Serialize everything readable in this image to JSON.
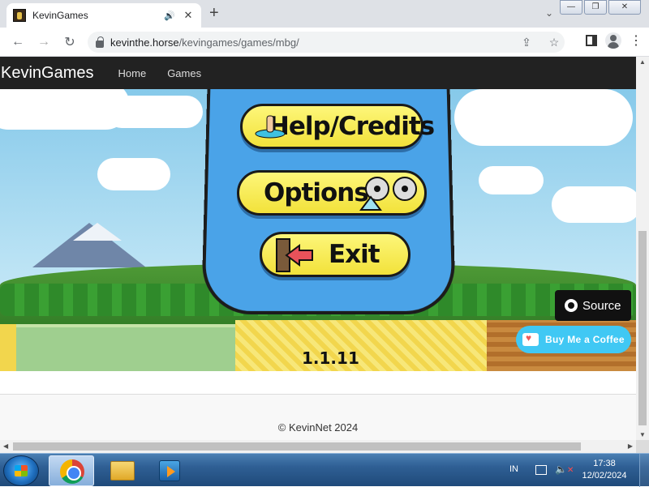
{
  "browser": {
    "tab": {
      "title": "KevinGames",
      "audio_icon": "speaker-icon",
      "close_icon": "close-icon"
    },
    "new_tab_icon": "plus-icon",
    "tab_search_icon": "chevron-down-icon",
    "window_controls": [
      "minimize",
      "restore",
      "close"
    ],
    "address": {
      "domain": "kevinthe.horse",
      "path": "/kevingames/games/mbg/"
    },
    "nav_icons": [
      "back-arrow-icon",
      "forward-arrow-icon",
      "reload-icon"
    ],
    "omnibox_icons": [
      "share-icon",
      "bookmark-star-icon"
    ],
    "toolbar_icons": [
      "side-panel-icon",
      "profile-icon",
      "menu-icon"
    ]
  },
  "site": {
    "brand": "KevinGames",
    "nav": [
      {
        "label": "Home"
      },
      {
        "label": "Games"
      }
    ]
  },
  "game": {
    "menu_buttons": [
      {
        "label": "Help/Credits",
        "icon": "drowning-hand-icon"
      },
      {
        "label": "Options",
        "icon": "film-reels-icon"
      },
      {
        "label": "Exit",
        "icon": "exit-door-arrow-icon"
      }
    ],
    "version": "1.1.11",
    "source_button": {
      "label": "Source",
      "icon": "github-icon"
    },
    "coffee_button": {
      "label": "Buy Me a Coffee",
      "icon": "coffee-cup-icon"
    }
  },
  "footer": {
    "copyright": "© KevinNet 2024"
  },
  "taskbar": {
    "apps": [
      "chrome-icon",
      "file-explorer-icon",
      "media-player-icon"
    ],
    "language": "IN",
    "time": "17:38",
    "date": "12/02/2024"
  }
}
